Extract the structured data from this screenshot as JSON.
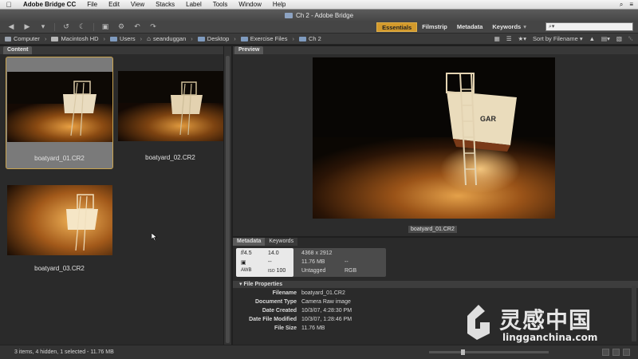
{
  "menubar": {
    "apple": "",
    "app": "Adobe Bridge CC",
    "items": [
      "File",
      "Edit",
      "View",
      "Stacks",
      "Label",
      "Tools",
      "Window",
      "Help"
    ]
  },
  "window": {
    "title": "Ch 2 - Adobe Bridge"
  },
  "toolbar": {
    "workspaces": [
      "Essentials",
      "Filmstrip",
      "Metadata",
      "Keywords"
    ],
    "active_workspace": "Essentials",
    "search_placeholder": "⌕▾"
  },
  "path": {
    "crumbs": [
      "Computer",
      "Macintosh HD",
      "Users",
      "seanduggan",
      "Desktop",
      "Exercise Files",
      "Ch 2"
    ],
    "sort_label": "Sort by Filename"
  },
  "content": {
    "tab": "Content",
    "thumbnails": [
      {
        "name": "boatyard_01.CR2",
        "selected": true
      },
      {
        "name": "boatyard_02.CR2",
        "selected": false
      },
      {
        "name": "boatyard_03.CR2",
        "selected": false
      }
    ]
  },
  "preview": {
    "tab": "Preview",
    "caption": "boatyard_01.CR2"
  },
  "metadata": {
    "tabs": [
      "Metadata",
      "Keywords"
    ],
    "camera": {
      "aperture": "4.5",
      "shutter": "14.0",
      "metering": "--",
      "white_balance": "AWB",
      "iso": "100",
      "iso_label": "ISO",
      "dimensions": "4368 x 2912",
      "size": "11.76 MB",
      "resolution": "--",
      "color_profile": "Untagged",
      "color_mode": "RGB"
    },
    "section": "File Properties",
    "properties": [
      {
        "key": "Filename",
        "value": "boatyard_01.CR2"
      },
      {
        "key": "Document Type",
        "value": "Camera Raw image"
      },
      {
        "key": "Date Created",
        "value": "10/3/07, 4:28:30 PM"
      },
      {
        "key": "Date File Modified",
        "value": "10/3/07, 1:28:46 PM"
      },
      {
        "key": "File Size",
        "value": "11.76 MB"
      }
    ]
  },
  "status": {
    "text": "3 items, 4 hidden, 1 selected - 11.76 MB"
  },
  "watermark": {
    "text": "灵感中国",
    "url": "lingganchina.com"
  }
}
